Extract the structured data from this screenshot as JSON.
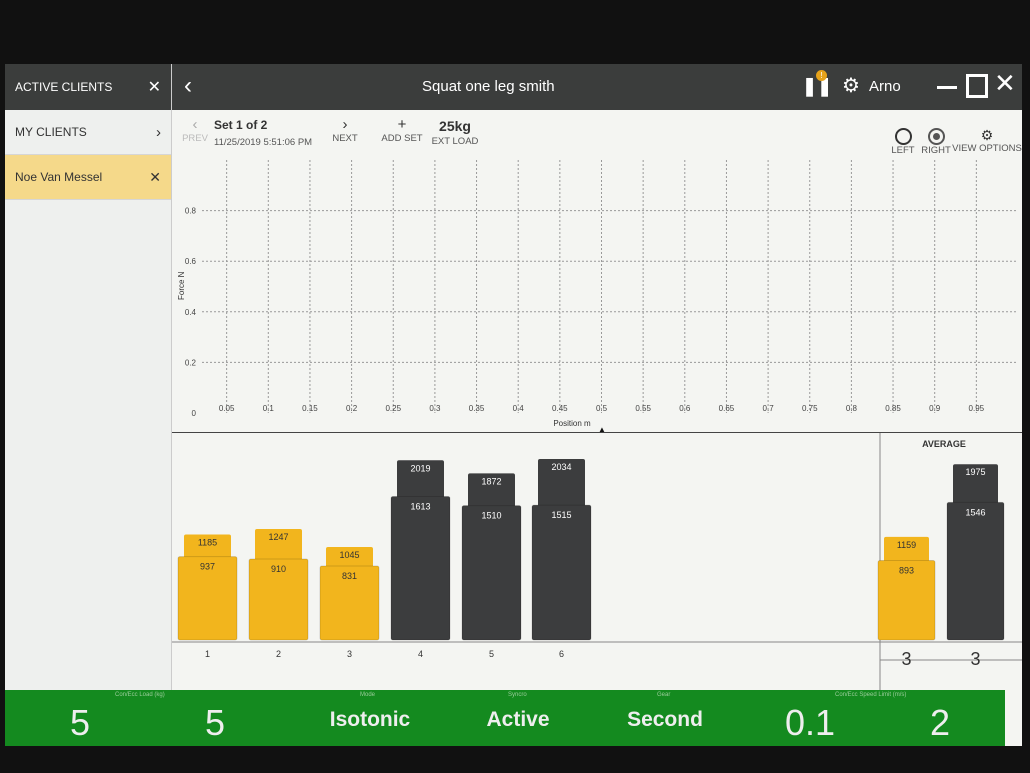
{
  "sidebar": {
    "header": "ACTIVE CLIENTS",
    "items": [
      {
        "label": "MY CLIENTS",
        "icon": "chevron-right-icon"
      },
      {
        "label": "Noe Van Messel",
        "icon": "close-icon",
        "selected": true
      }
    ]
  },
  "titlebar": {
    "title": "Squat one leg smith",
    "user": "Arno",
    "alert_badge": "!"
  },
  "toolbar": {
    "prev_label": "PREV",
    "set_label": "Set 1 of 2",
    "timestamp": "11/25/2019 5:51:06 PM",
    "next_label": "NEXT",
    "add_set_label": "ADD SET",
    "add_set_icon": "+",
    "ext_load_value": "25kg",
    "ext_load_label": "EXT LOAD",
    "left_label": "LEFT",
    "right_label": "RIGHT",
    "view_options_label": "VIEW OPTIONS",
    "selected_side": "RIGHT"
  },
  "chart_data": [
    {
      "type": "line",
      "xlabel": "Position m",
      "ylabel": "Force N",
      "xlim": [
        0,
        1
      ],
      "ylim": [
        0,
        1
      ],
      "grid": true,
      "x_ticks": [
        "0.05",
        "0.1",
        "0.15",
        "0.2",
        "0.25",
        "0.3",
        "0.35",
        "0.4",
        "0.45",
        "0.5",
        "0.55",
        "0.6",
        "0.65",
        "0.7",
        "0.75",
        "0.8",
        "0.85",
        "0.9",
        "0.95"
      ],
      "y_ticks": [
        "0",
        "0.2",
        "0.4",
        "0.6",
        "0.8"
      ],
      "series": []
    },
    {
      "type": "bar",
      "categories": [
        "1",
        "2",
        "3",
        "4",
        "5",
        "6"
      ],
      "series": [
        {
          "values": [
            1185,
            1247,
            1045,
            2019,
            1872,
            2034
          ]
        },
        {
          "values": [
            937,
            910,
            831,
            1613,
            1510,
            1515
          ]
        }
      ],
      "colors": [
        "#f2b51d",
        "#f2b51d",
        "#f2b51d",
        "#3c3d3e",
        "#3c3d3e",
        "#3c3d3e"
      ]
    },
    {
      "type": "bar",
      "title": "AVERAGE",
      "categories": [
        "3",
        "3"
      ],
      "series": [
        {
          "values": [
            1159,
            1975
          ]
        },
        {
          "values": [
            893,
            1546
          ]
        }
      ],
      "colors": [
        "#f2b51d",
        "#3c3d3e"
      ]
    }
  ],
  "footer": {
    "labels": [
      "Con/Ecc Load (kg)",
      "Mode",
      "Syncro",
      "Gear",
      "Con/Ecc Speed Limit (m/s)"
    ],
    "con_load": "5",
    "ecc_load": "5",
    "mode": "Isotonic",
    "syncro": "Active",
    "gear": "Second",
    "con_speed": "0.1",
    "ecc_speed": "2",
    "color": "#148a1f"
  }
}
